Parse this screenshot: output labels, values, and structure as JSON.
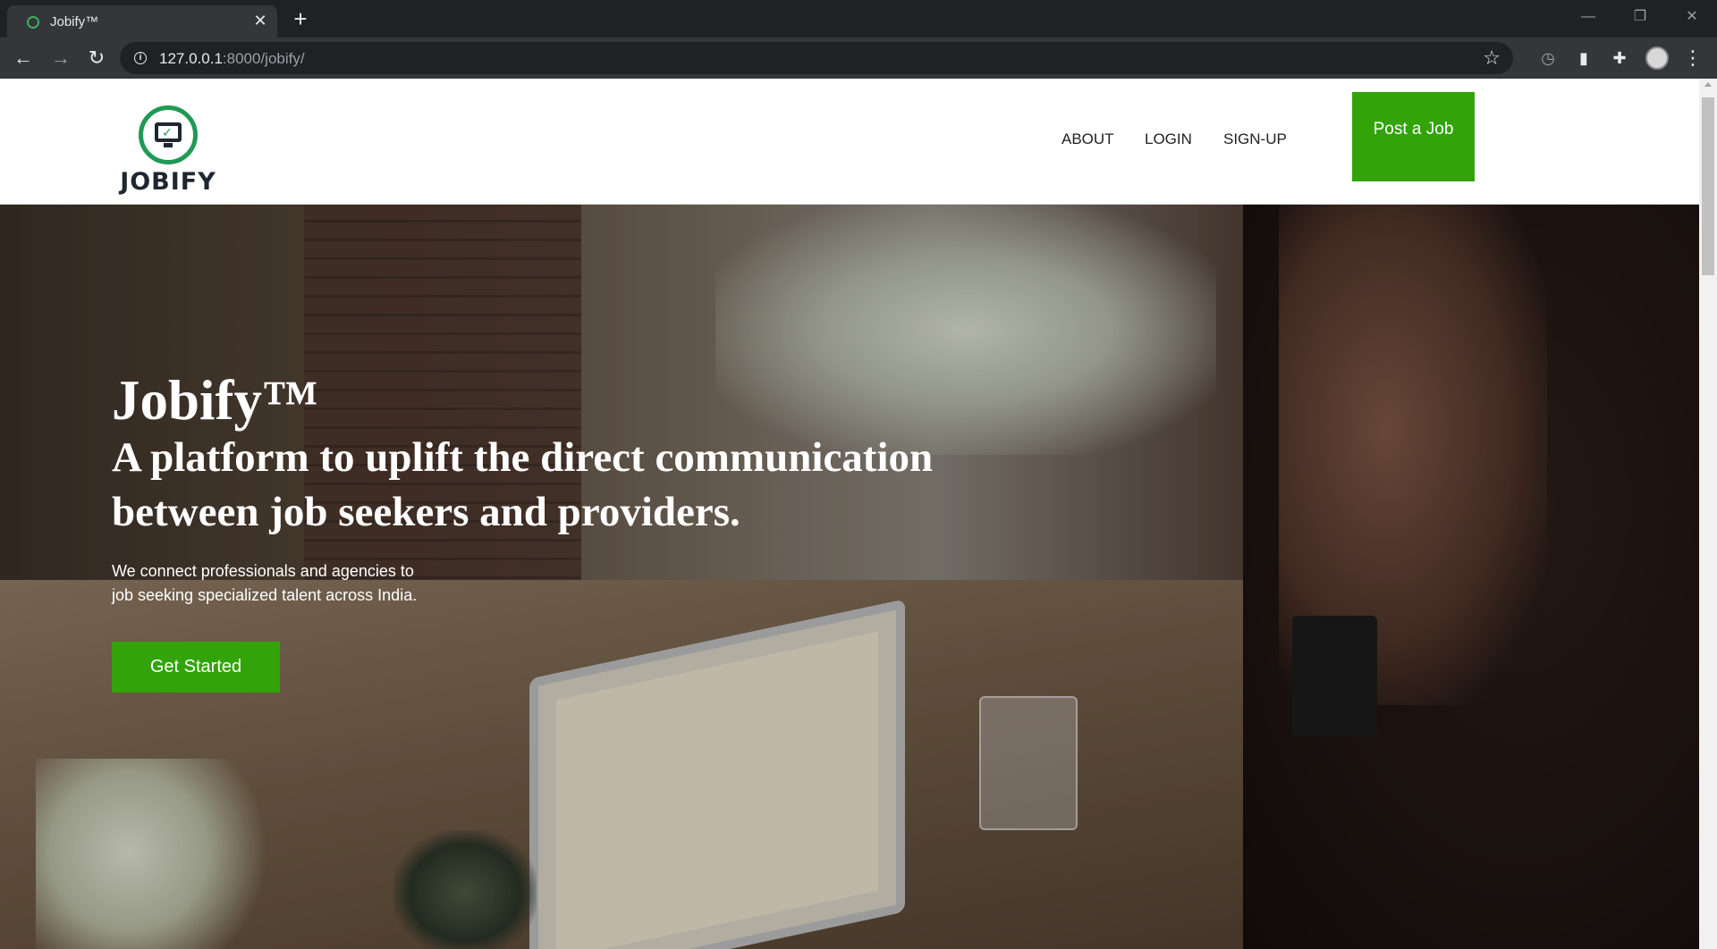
{
  "browser": {
    "tab_title": "Jobify™",
    "url_host": "127.0.0.1",
    "url_path": ":8000/jobify/"
  },
  "header": {
    "logo_text": "JOBIFY",
    "nav": [
      "ABOUT",
      "LOGIN",
      "SIGN-UP"
    ],
    "cta": "Post a Job"
  },
  "hero": {
    "brand": "Jobify™",
    "headline_1": "A platform to uplift the direct communication",
    "headline_2": "between job seekers and providers.",
    "sub_1": "We connect professionals and agencies to",
    "sub_2": "job seeking specialized talent across India.",
    "cta": "Get Started"
  },
  "colors": {
    "brand_green": "#32a309",
    "logo_green": "#1f9a55",
    "chrome_dark": "#202124",
    "chrome_toolbar": "#35363a"
  }
}
